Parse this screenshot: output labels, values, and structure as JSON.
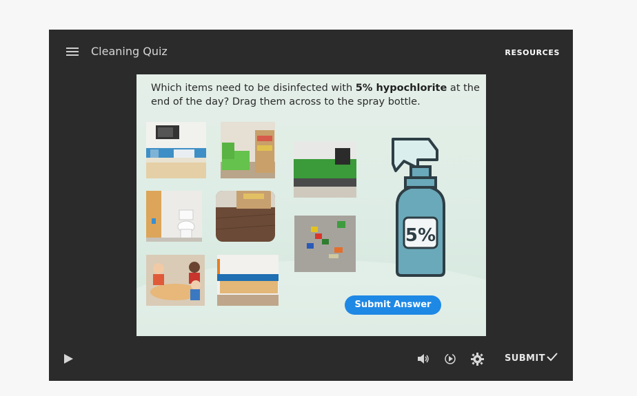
{
  "header": {
    "title": "Cleaning Quiz",
    "resources_label": "RESOURCES"
  },
  "question": {
    "prefix": "Which items need to be disinfected with ",
    "highlight": "5% hypochlorite",
    "suffix": " at the end of the day? Drag them across to the spray bottle."
  },
  "items": [
    {
      "icon": "kitchen-microwave"
    },
    {
      "icon": "green-sofa-shelf"
    },
    {
      "icon": "sink-paper-towel"
    },
    {
      "icon": "toilet"
    },
    {
      "icon": "wooden-floor"
    },
    {
      "icon": "toy-blocks-rug"
    },
    {
      "icon": "children-eating"
    },
    {
      "icon": "changing-table"
    }
  ],
  "bottle": {
    "label": "5%",
    "color": "#6aa9b9"
  },
  "submit_answer_label": "Submit Answer",
  "footer": {
    "submit_label": "SUBMIT"
  },
  "colors": {
    "player_bg": "#2b2b2b",
    "slide_bg": "#e4efe8",
    "button_blue": "#1e88e5"
  }
}
